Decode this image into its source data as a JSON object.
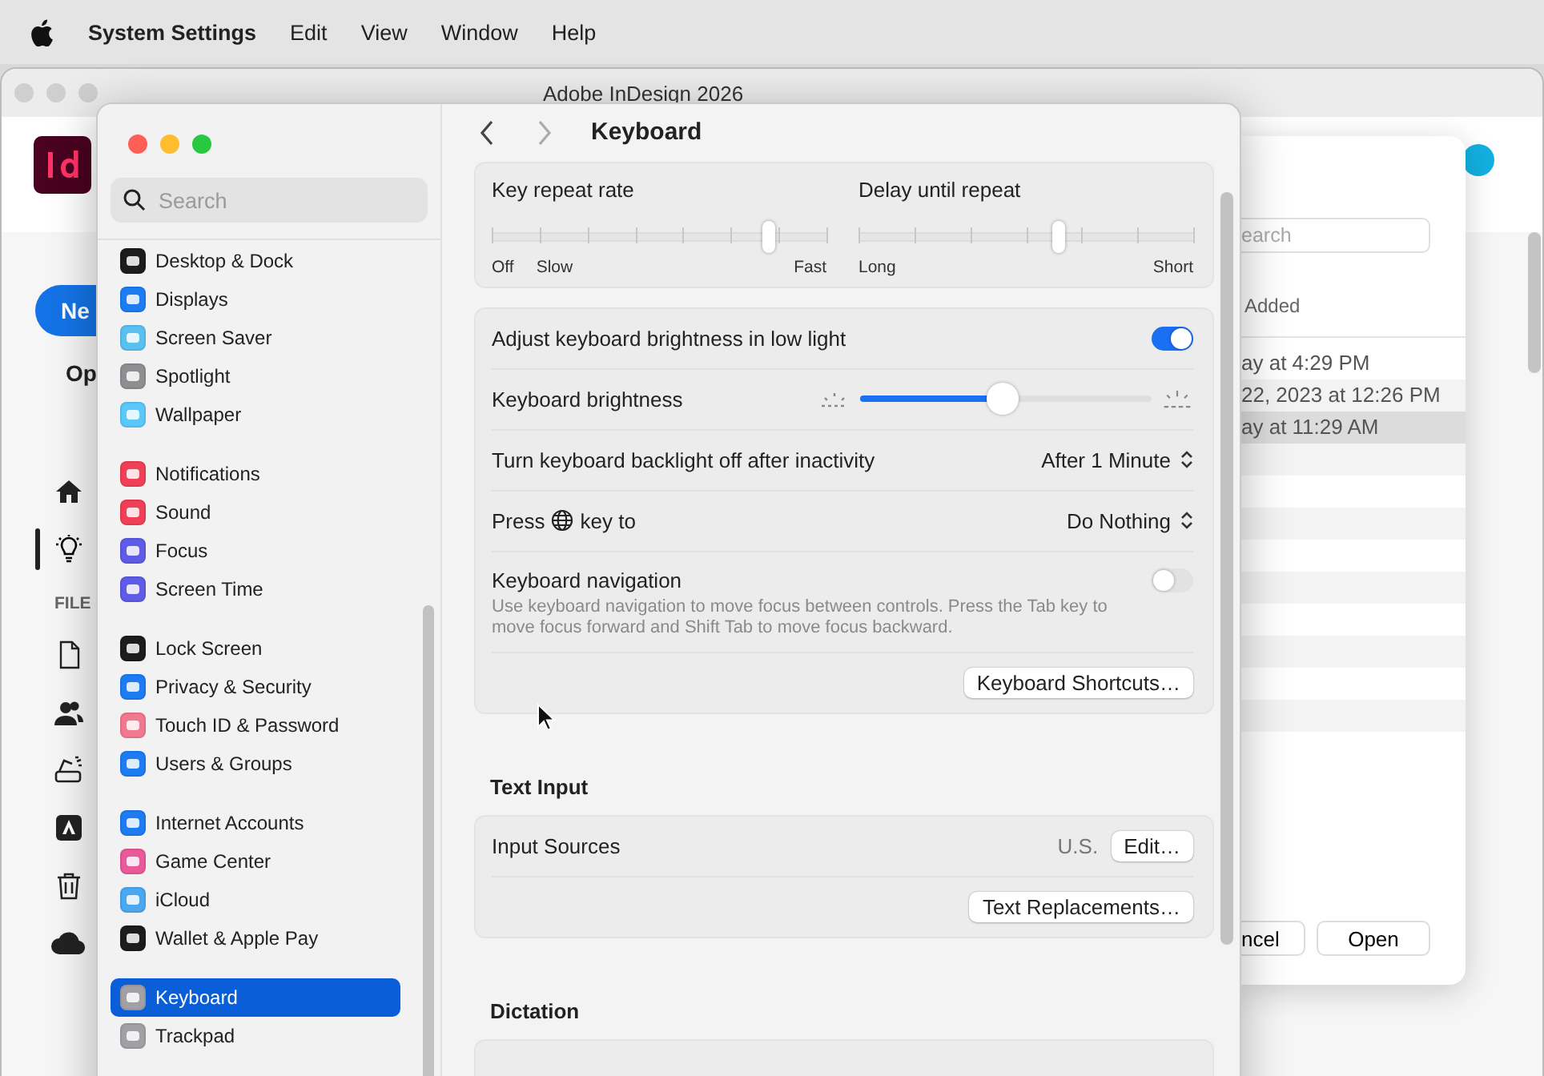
{
  "menu_bar": {
    "app_name": "System Settings",
    "items": [
      "Edit",
      "View",
      "Window",
      "Help"
    ]
  },
  "indesign_window": {
    "title": "Adobe InDesign 2026",
    "new_button": "Ne",
    "open_link": "Op",
    "files_heading": "FILE",
    "rail": [
      {
        "kind": "home",
        "selected": false
      },
      {
        "kind": "lightbulb",
        "selected": true
      }
    ],
    "file_nav": [
      {
        "kind": "document"
      },
      {
        "kind": "people"
      },
      {
        "kind": "scanner"
      },
      {
        "kind": "app"
      },
      {
        "kind": "trash"
      },
      {
        "kind": "cloud"
      }
    ]
  },
  "open_dialog": {
    "search_placeholder": "earch",
    "column_heading": "Added",
    "rows": [
      {
        "text": "ay at 4:29 PM",
        "selected": false
      },
      {
        "text": "22, 2023 at 12:26 PM",
        "selected": false
      },
      {
        "text": "ay at 11:29 AM",
        "selected": true
      }
    ],
    "cancel_button": "ncel",
    "open_button": "Open"
  },
  "settings": {
    "search_placeholder": "Search",
    "sidebar_groups": [
      {
        "items": [
          {
            "label": "Desktop & Dock",
            "color": "#1c1c1e",
            "selected": false
          },
          {
            "label": "Displays",
            "color": "#1e7cf2",
            "selected": false
          },
          {
            "label": "Screen Saver",
            "color": "#5ac0f0",
            "selected": false
          },
          {
            "label": "Spotlight",
            "color": "#8e8e93",
            "selected": false
          },
          {
            "label": "Wallpaper",
            "color": "#5ac8fa",
            "selected": false
          }
        ]
      },
      {
        "items": [
          {
            "label": "Notifications",
            "color": "#ef4056",
            "selected": false
          },
          {
            "label": "Sound",
            "color": "#ef4056",
            "selected": false
          },
          {
            "label": "Focus",
            "color": "#5e5ce6",
            "selected": false
          },
          {
            "label": "Screen Time",
            "color": "#5e5ce6",
            "selected": false
          }
        ]
      },
      {
        "items": [
          {
            "label": "Lock Screen",
            "color": "#1c1c1e",
            "selected": false
          },
          {
            "label": "Privacy & Security",
            "color": "#1e7cf2",
            "selected": false
          },
          {
            "label": "Touch ID & Password",
            "color": "#f07890",
            "selected": false
          },
          {
            "label": "Users & Groups",
            "color": "#1e7cf2",
            "selected": false
          }
        ]
      },
      {
        "items": [
          {
            "label": "Internet Accounts",
            "color": "#1e7cf2",
            "selected": false
          },
          {
            "label": "Game Center",
            "color": "#e85a9a",
            "selected": false
          },
          {
            "label": "iCloud",
            "color": "#4aa8f0",
            "selected": false
          },
          {
            "label": "Wallet & Apple Pay",
            "color": "#1c1c1e",
            "selected": false
          }
        ]
      },
      {
        "items": [
          {
            "label": "Keyboard",
            "color": "#a0a0a5",
            "selected": true
          },
          {
            "label": "Trackpad",
            "color": "#a0a0a5",
            "selected": false
          }
        ]
      }
    ],
    "title": "Keyboard",
    "repeat_sliders": [
      {
        "label": "Key repeat rate",
        "level": 0.84,
        "labels_left": [
          "Off",
          "Slow"
        ],
        "labels_right": [
          "Fast"
        ]
      },
      {
        "label": "Delay until repeat",
        "level": 0.6,
        "labels_left": [
          "Long"
        ],
        "labels_right": [
          "Short"
        ]
      }
    ],
    "keyboard_rows": [
      {
        "kind": "toggle",
        "label": "Adjust keyboard brightness in low light",
        "on": true
      },
      {
        "kind": "slider",
        "label": "Keyboard brightness",
        "level": 0.49
      },
      {
        "kind": "popup",
        "label": "Turn keyboard backlight off after inactivity",
        "value": "After 1 Minute"
      },
      {
        "kind": "globe_popup",
        "label_before": "Press",
        "label_after": "key to",
        "value": "Do Nothing"
      },
      {
        "kind": "toggle",
        "label": "Keyboard navigation",
        "on": false,
        "description": "Use keyboard navigation to move focus between controls. Press the Tab key to move focus forward and Shift Tab to move focus backward."
      },
      {
        "kind": "button",
        "button": "Keyboard Shortcuts…"
      }
    ],
    "text_input_heading": "Text Input",
    "text_input_rows": [
      {
        "kind": "value_button",
        "label": "Input Sources",
        "value": "U.S.",
        "button": "Edit…"
      },
      {
        "kind": "button",
        "button": "Text Replacements…"
      }
    ],
    "dictation_heading": "Dictation"
  }
}
